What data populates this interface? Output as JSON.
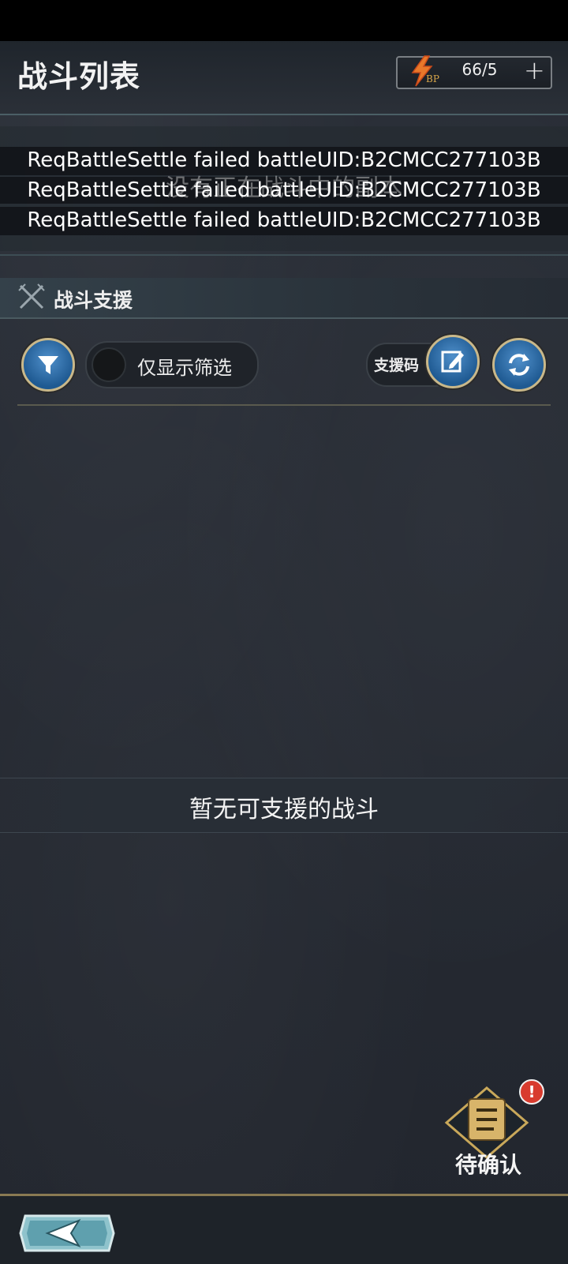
{
  "header": {
    "title": "战斗列表",
    "bp": {
      "label": "BP",
      "value": "66/5",
      "plus": "+"
    }
  },
  "errors": {
    "lines": [
      "ReqBattleSettle failed battleUID:B2CMCC277103B",
      "ReqBattleSettle failed battleUID:B2CMCC277103B",
      "ReqBattleSettle failed battleUID:B2CMCC277103B"
    ],
    "toast": "没有正在战斗中的副本"
  },
  "section": {
    "title": "战斗支援"
  },
  "filters": {
    "show_filter_label": "仅显示筛选",
    "support_code_label": "支援码"
  },
  "empty_state": {
    "text": "暂无可支援的战斗"
  },
  "pending": {
    "badge": "!",
    "label": "待确认"
  },
  "colors": {
    "background": "#252a33",
    "button_blue": "#2d6ca8",
    "gold_border": "#c9b88a",
    "badge_red": "#d83b2e",
    "bp_orange": "#e8782a"
  },
  "icons": {
    "filter": "funnel-icon",
    "edit": "edit-note-icon",
    "refresh": "refresh-icon",
    "back": "back-arrow-icon",
    "section": "crossed-swords-icon",
    "pending": "scroll-list-icon",
    "bp": "lightning-icon"
  }
}
